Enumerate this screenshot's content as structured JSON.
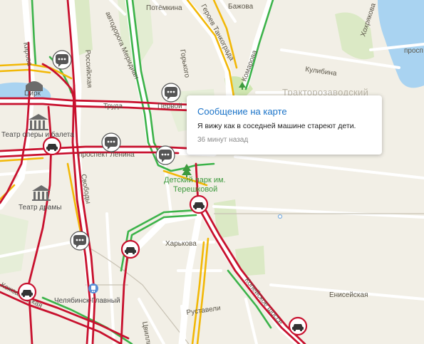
{
  "map": {
    "streets": [
      "Кирова",
      "Российская",
      "автодорога Меридиан",
      "Потёмкина",
      "Бажова",
      "Героев Танкограда",
      "Горького",
      "Комарова",
      "Кулибина",
      "Хохрякова",
      "проспект Победы",
      "Труда",
      "Первой пятилетки",
      "проспект Ленина",
      "Свободы",
      "Харьковская",
      "Руставели",
      "Енисейская",
      "Копейское шоссе",
      "Кожзаводская",
      "Цвиллинга",
      "Тракторозаводский"
    ],
    "pois": {
      "circus": "Цирк",
      "opera": "Театр оперы и балета",
      "drama": "Театр драмы",
      "park": "Детский парк им. Терешковой",
      "park_line1": "Детский парк им.",
      "park_line2": "Терешковой",
      "station": "Челябинск-Главный"
    },
    "district": "Тракторозаводский",
    "labels": {
      "kirova": "Кирова",
      "rossiyskaya": "Российская",
      "meridian": "автодорога Меридиан",
      "potemkina": "Потёмкина",
      "bazhova": "Бажова",
      "tankograda": "Героев Танкограда",
      "gorkogo": "Горького",
      "komarova": "Комарова",
      "kulibina": "Кулибина",
      "khokhryakova": "Хохрякова",
      "prospect": "просп",
      "truda": "Труда",
      "pervoy": "Первой",
      "lenina": "проспект Ленина",
      "svobody": "Свободы",
      "kharkovskaya": "Харькова",
      "rustaveli": "Руставели",
      "eniseyskaya": "Енисейская",
      "kopeyskoe": "Копейское шоссе",
      "kozhzavod": "Кожзаводская",
      "tsvillinga": "Цвиллинга"
    },
    "colors": {
      "jam": "#c8112e",
      "slow": "#f2b807",
      "free": "#3cb34a",
      "road": "#ffffff",
      "park": "#cfe6b0"
    }
  },
  "popup": {
    "title": "Сообщение на карте",
    "text": "Я вижу как в соседней машине стареют дети.",
    "time": "36 минут назад"
  }
}
